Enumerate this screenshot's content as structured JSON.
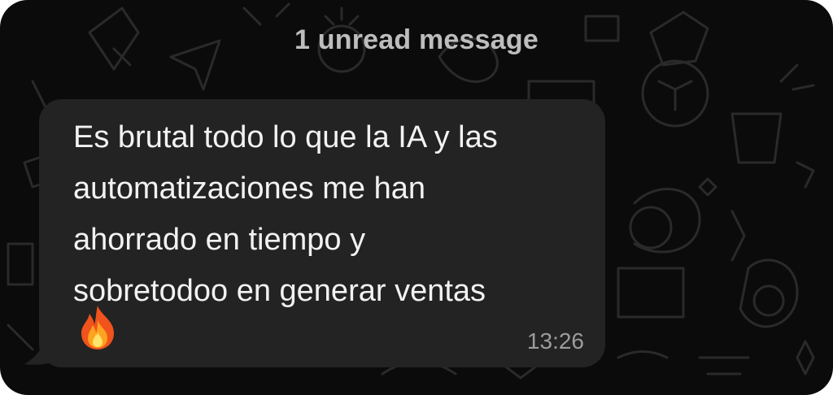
{
  "chat": {
    "unread_divider": "1 unread message",
    "message": {
      "text_lines": [
        "Es brutal todo lo que la IA y las",
        "automatizaciones me han",
        "ahorrado en tiempo y",
        "sobretodoo en generar ventas"
      ],
      "emoji": "🔥",
      "emoji_icon": "fire-icon",
      "time": "13:26"
    }
  },
  "colors": {
    "background": "#0b0b0b",
    "bubble": "#232323",
    "message_text": "#f2f2f2",
    "divider_text": "#bdbdbd",
    "timestamp": "#9c9c9c"
  }
}
